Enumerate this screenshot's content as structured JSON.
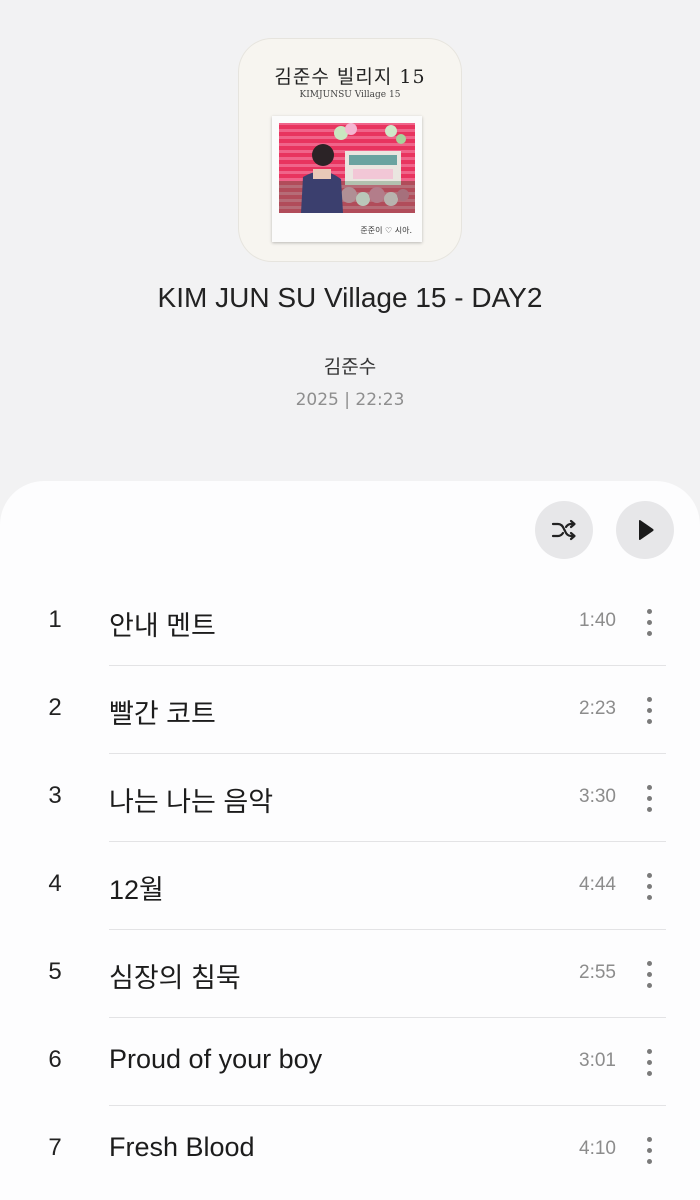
{
  "album": {
    "cover": {
      "title": "김준수 빌리지 15",
      "subtitle": "KIMJUNSU Village 15",
      "caption": "준준이 ♡ 시아."
    },
    "title": "KIM JUN SU Village 15 - DAY2",
    "artist": "김준수",
    "meta": "2025 | 22:23"
  },
  "controls": {
    "shuffle_icon": "shuffle-icon",
    "play_icon": "play-icon"
  },
  "tracks": [
    {
      "number": "1",
      "title": "안내 멘트",
      "duration": "1:40"
    },
    {
      "number": "2",
      "title": "빨간 코트",
      "duration": "2:23"
    },
    {
      "number": "3",
      "title": "나는 나는 음악",
      "duration": "3:30"
    },
    {
      "number": "4",
      "title": "12월",
      "duration": "4:44"
    },
    {
      "number": "5",
      "title": "심장의 침묵",
      "duration": "2:55"
    },
    {
      "number": "6",
      "title": "Proud of your boy",
      "duration": "3:01"
    },
    {
      "number": "7",
      "title": "Fresh Blood",
      "duration": "4:10"
    }
  ]
}
